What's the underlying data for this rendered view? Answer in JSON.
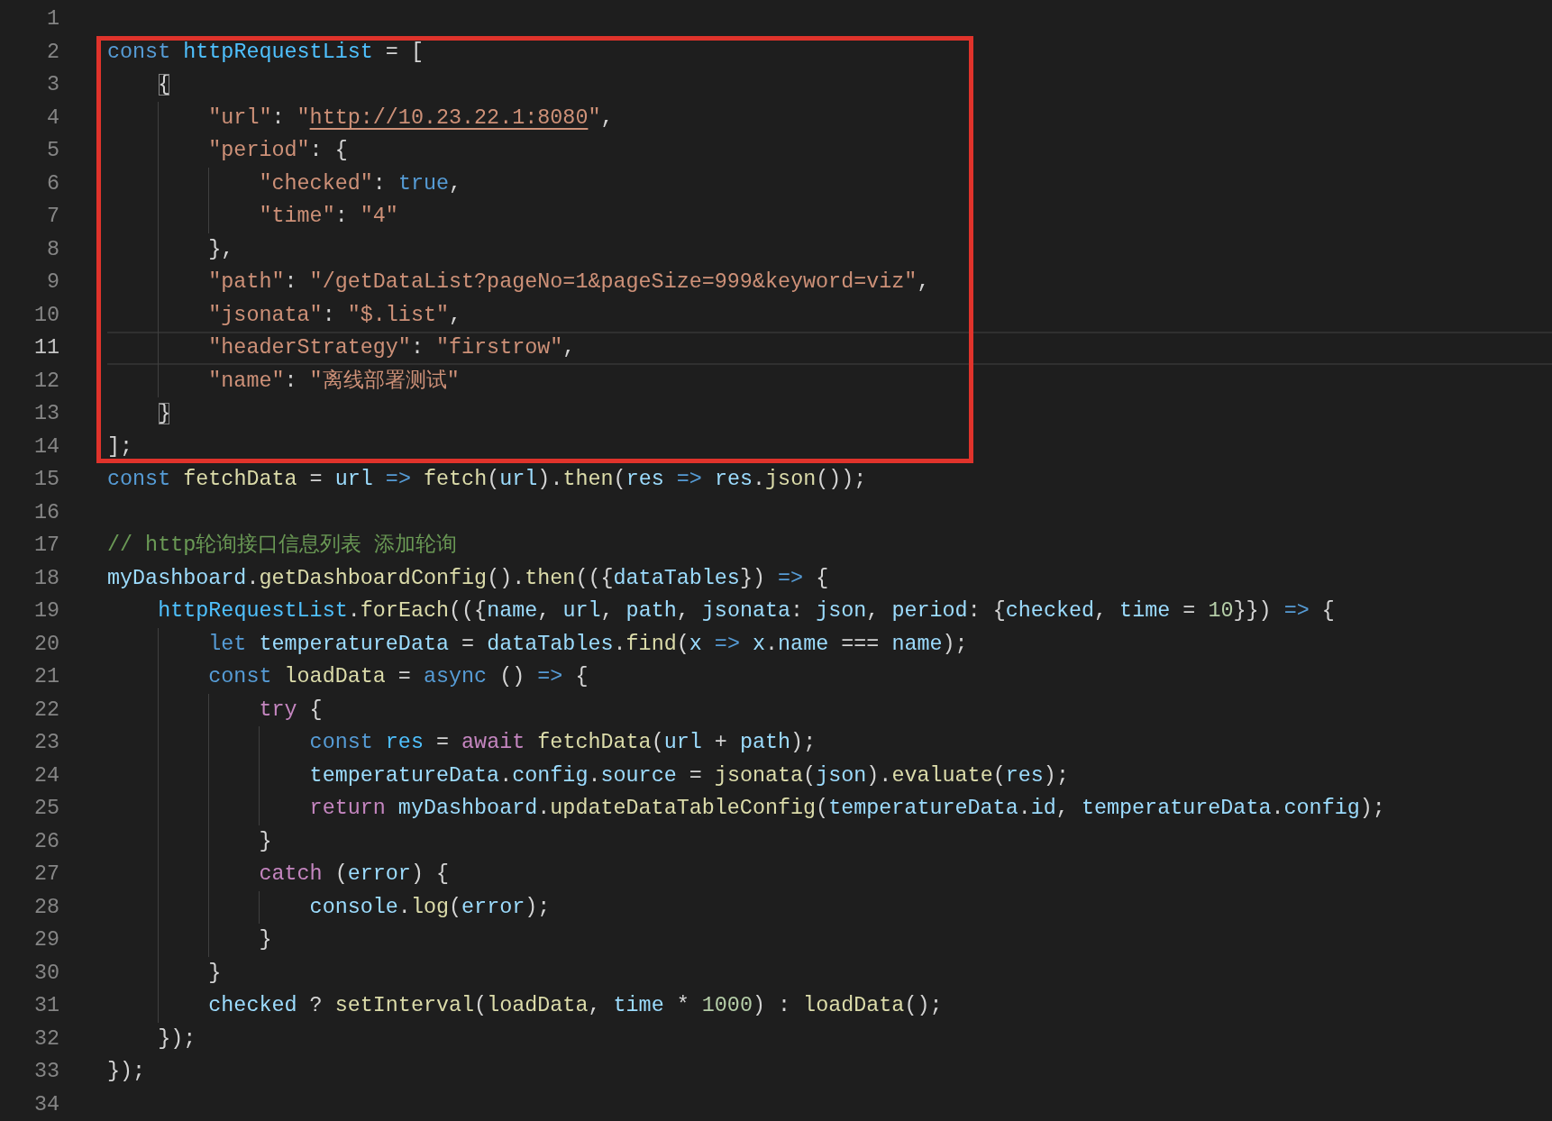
{
  "lines": [
    {
      "number": "1",
      "current": false,
      "in_box": false
    },
    {
      "number": "2",
      "current": false,
      "in_box": true,
      "tokens": [
        {
          "kind": "kw",
          "text": "const "
        },
        {
          "kind": "cst",
          "text": "httpRequestList"
        },
        {
          "kind": "p",
          "text": " = ["
        }
      ]
    },
    {
      "number": "3",
      "current": false,
      "in_box": true,
      "tokens": [
        {
          "kind": "match",
          "text": "    {"
        }
      ]
    },
    {
      "number": "4",
      "current": false,
      "in_box": true,
      "tokens": [
        {
          "kind": "str",
          "text": "        \"url\""
        },
        {
          "kind": "p",
          "text": ": "
        },
        {
          "kind": "str",
          "text": "\""
        },
        {
          "kind": "link",
          "text": "http://10.23.22.1:8080"
        },
        {
          "kind": "str",
          "text": "\""
        },
        {
          "kind": "p",
          "text": ","
        }
      ]
    },
    {
      "number": "5",
      "current": false,
      "in_box": true,
      "tokens": [
        {
          "kind": "str",
          "text": "        \"period\""
        },
        {
          "kind": "p",
          "text": ": {"
        }
      ]
    },
    {
      "number": "6",
      "current": false,
      "in_box": true,
      "tokens": [
        {
          "kind": "str",
          "text": "            \"checked\""
        },
        {
          "kind": "p",
          "text": ": "
        },
        {
          "kind": "kw",
          "text": "true"
        },
        {
          "kind": "p",
          "text": ","
        }
      ]
    },
    {
      "number": "7",
      "current": false,
      "in_box": true,
      "tokens": [
        {
          "kind": "str",
          "text": "            \"time\""
        },
        {
          "kind": "p",
          "text": ": "
        },
        {
          "kind": "str",
          "text": "\"4\""
        }
      ]
    },
    {
      "number": "8",
      "current": false,
      "in_box": true,
      "tokens": [
        {
          "kind": "p",
          "text": "        },"
        }
      ]
    },
    {
      "number": "9",
      "current": false,
      "in_box": true,
      "tokens": [
        {
          "kind": "str",
          "text": "        \"path\""
        },
        {
          "kind": "p",
          "text": ": "
        },
        {
          "kind": "str",
          "text": "\"/getDataList?pageNo=1&pageSize=999&keyword=viz\""
        },
        {
          "kind": "p",
          "text": ","
        }
      ]
    },
    {
      "number": "10",
      "current": false,
      "in_box": true,
      "tokens": [
        {
          "kind": "str",
          "text": "        \"jsonata\""
        },
        {
          "kind": "p",
          "text": ": "
        },
        {
          "kind": "str",
          "text": "\"$.list\""
        },
        {
          "kind": "p",
          "text": ","
        }
      ]
    },
    {
      "number": "11",
      "current": true,
      "in_box": true,
      "tokens": [
        {
          "kind": "str",
          "text": "        \"headerStrategy\""
        },
        {
          "kind": "p",
          "text": ": "
        },
        {
          "kind": "str",
          "text": "\"firstrow\""
        },
        {
          "kind": "p",
          "text": ","
        }
      ]
    },
    {
      "number": "12",
      "current": false,
      "in_box": true,
      "tokens": [
        {
          "kind": "str",
          "text": "        \"name\""
        },
        {
          "kind": "p",
          "text": ": "
        },
        {
          "kind": "str",
          "text": "\"离线部署测试\""
        }
      ]
    },
    {
      "number": "13",
      "current": false,
      "in_box": true,
      "tokens": [
        {
          "kind": "match",
          "text": "    }"
        }
      ]
    },
    {
      "number": "14",
      "current": false,
      "in_box": true,
      "tokens": [
        {
          "kind": "p",
          "text": "];"
        }
      ]
    },
    {
      "number": "15",
      "current": false,
      "in_box": false,
      "tokens": [
        {
          "kind": "kw",
          "text": "const "
        },
        {
          "kind": "fn",
          "text": "fetchData"
        },
        {
          "kind": "p",
          "text": " = "
        },
        {
          "kind": "var",
          "text": "url"
        },
        {
          "kind": "kw",
          "text": " => "
        },
        {
          "kind": "fn",
          "text": "fetch"
        },
        {
          "kind": "p",
          "text": "("
        },
        {
          "kind": "var",
          "text": "url"
        },
        {
          "kind": "p",
          "text": ")."
        },
        {
          "kind": "fn",
          "text": "then"
        },
        {
          "kind": "p",
          "text": "("
        },
        {
          "kind": "var",
          "text": "res"
        },
        {
          "kind": "kw",
          "text": " => "
        },
        {
          "kind": "var",
          "text": "res"
        },
        {
          "kind": "p",
          "text": "."
        },
        {
          "kind": "fn",
          "text": "json"
        },
        {
          "kind": "p",
          "text": "());"
        }
      ]
    },
    {
      "number": "16",
      "current": false,
      "in_box": false
    },
    {
      "number": "17",
      "current": false,
      "in_box": false,
      "tokens": [
        {
          "kind": "cmt",
          "text": "// http轮询接口信息列表 添加轮询"
        }
      ]
    },
    {
      "number": "18",
      "current": false,
      "in_box": false,
      "tokens": [
        {
          "kind": "var",
          "text": "myDashboard"
        },
        {
          "kind": "p",
          "text": "."
        },
        {
          "kind": "fn",
          "text": "getDashboardConfig"
        },
        {
          "kind": "p",
          "text": "()."
        },
        {
          "kind": "fn",
          "text": "then"
        },
        {
          "kind": "p",
          "text": "(({"
        },
        {
          "kind": "var",
          "text": "dataTables"
        },
        {
          "kind": "p",
          "text": "}) "
        },
        {
          "kind": "kw",
          "text": "=>"
        },
        {
          "kind": "p",
          "text": " {"
        }
      ]
    },
    {
      "number": "19",
      "current": false,
      "in_box": false,
      "tokens": [
        {
          "kind": "cst",
          "text": "    httpRequestList"
        },
        {
          "kind": "p",
          "text": "."
        },
        {
          "kind": "fn",
          "text": "forEach"
        },
        {
          "kind": "p",
          "text": "(({"
        },
        {
          "kind": "var",
          "text": "name"
        },
        {
          "kind": "p",
          "text": ", "
        },
        {
          "kind": "var",
          "text": "url"
        },
        {
          "kind": "p",
          "text": ", "
        },
        {
          "kind": "var",
          "text": "path"
        },
        {
          "kind": "p",
          "text": ", "
        },
        {
          "kind": "var",
          "text": "jsonata"
        },
        {
          "kind": "p",
          "text": ": "
        },
        {
          "kind": "var",
          "text": "json"
        },
        {
          "kind": "p",
          "text": ", "
        },
        {
          "kind": "var",
          "text": "period"
        },
        {
          "kind": "p",
          "text": ": {"
        },
        {
          "kind": "var",
          "text": "checked"
        },
        {
          "kind": "p",
          "text": ", "
        },
        {
          "kind": "var",
          "text": "time"
        },
        {
          "kind": "p",
          "text": " = "
        },
        {
          "kind": "num",
          "text": "10"
        },
        {
          "kind": "p",
          "text": "}}) "
        },
        {
          "kind": "kw",
          "text": "=>"
        },
        {
          "kind": "p",
          "text": " {"
        }
      ]
    },
    {
      "number": "20",
      "current": false,
      "in_box": false,
      "tokens": [
        {
          "kind": "kw",
          "text": "        let "
        },
        {
          "kind": "var",
          "text": "temperatureData"
        },
        {
          "kind": "p",
          "text": " = "
        },
        {
          "kind": "var",
          "text": "dataTables"
        },
        {
          "kind": "p",
          "text": "."
        },
        {
          "kind": "fn",
          "text": "find"
        },
        {
          "kind": "p",
          "text": "("
        },
        {
          "kind": "var",
          "text": "x"
        },
        {
          "kind": "kw",
          "text": " => "
        },
        {
          "kind": "var",
          "text": "x"
        },
        {
          "kind": "p",
          "text": "."
        },
        {
          "kind": "var",
          "text": "name"
        },
        {
          "kind": "p",
          "text": " === "
        },
        {
          "kind": "var",
          "text": "name"
        },
        {
          "kind": "p",
          "text": ");"
        }
      ]
    },
    {
      "number": "21",
      "current": false,
      "in_box": false,
      "tokens": [
        {
          "kind": "kw",
          "text": "        const "
        },
        {
          "kind": "fn",
          "text": "loadData"
        },
        {
          "kind": "p",
          "text": " = "
        },
        {
          "kind": "kw",
          "text": "async"
        },
        {
          "kind": "p",
          "text": " () "
        },
        {
          "kind": "kw",
          "text": "=>"
        },
        {
          "kind": "p",
          "text": " {"
        }
      ]
    },
    {
      "number": "22",
      "current": false,
      "in_box": false,
      "tokens": [
        {
          "kind": "ctl",
          "text": "            try"
        },
        {
          "kind": "p",
          "text": " {"
        }
      ]
    },
    {
      "number": "23",
      "current": false,
      "in_box": false,
      "tokens": [
        {
          "kind": "kw",
          "text": "                const "
        },
        {
          "kind": "cst",
          "text": "res"
        },
        {
          "kind": "p",
          "text": " = "
        },
        {
          "kind": "ctl",
          "text": "await "
        },
        {
          "kind": "fn",
          "text": "fetchData"
        },
        {
          "kind": "p",
          "text": "("
        },
        {
          "kind": "var",
          "text": "url"
        },
        {
          "kind": "p",
          "text": " + "
        },
        {
          "kind": "var",
          "text": "path"
        },
        {
          "kind": "p",
          "text": ");"
        }
      ]
    },
    {
      "number": "24",
      "current": false,
      "in_box": false,
      "tokens": [
        {
          "kind": "var",
          "text": "                temperatureData"
        },
        {
          "kind": "p",
          "text": "."
        },
        {
          "kind": "var",
          "text": "config"
        },
        {
          "kind": "p",
          "text": "."
        },
        {
          "kind": "var",
          "text": "source"
        },
        {
          "kind": "p",
          "text": " = "
        },
        {
          "kind": "fn",
          "text": "jsonata"
        },
        {
          "kind": "p",
          "text": "("
        },
        {
          "kind": "var",
          "text": "json"
        },
        {
          "kind": "p",
          "text": ")."
        },
        {
          "kind": "fn",
          "text": "evaluate"
        },
        {
          "kind": "p",
          "text": "("
        },
        {
          "kind": "var",
          "text": "res"
        },
        {
          "kind": "p",
          "text": ");"
        }
      ]
    },
    {
      "number": "25",
      "current": false,
      "in_box": false,
      "tokens": [
        {
          "kind": "ctl",
          "text": "                return "
        },
        {
          "kind": "var",
          "text": "myDashboard"
        },
        {
          "kind": "p",
          "text": "."
        },
        {
          "kind": "fn",
          "text": "updateDataTableConfig"
        },
        {
          "kind": "p",
          "text": "("
        },
        {
          "kind": "var",
          "text": "temperatureData"
        },
        {
          "kind": "p",
          "text": "."
        },
        {
          "kind": "var",
          "text": "id"
        },
        {
          "kind": "p",
          "text": ", "
        },
        {
          "kind": "var",
          "text": "temperatureData"
        },
        {
          "kind": "p",
          "text": "."
        },
        {
          "kind": "var",
          "text": "config"
        },
        {
          "kind": "p",
          "text": ");"
        }
      ]
    },
    {
      "number": "26",
      "current": false,
      "in_box": false,
      "tokens": [
        {
          "kind": "p",
          "text": "            }"
        }
      ]
    },
    {
      "number": "27",
      "current": false,
      "in_box": false,
      "tokens": [
        {
          "kind": "ctl",
          "text": "            catch"
        },
        {
          "kind": "p",
          "text": " ("
        },
        {
          "kind": "var",
          "text": "error"
        },
        {
          "kind": "p",
          "text": ") {"
        }
      ]
    },
    {
      "number": "28",
      "current": false,
      "in_box": false,
      "tokens": [
        {
          "kind": "var",
          "text": "                console"
        },
        {
          "kind": "p",
          "text": "."
        },
        {
          "kind": "fn",
          "text": "log"
        },
        {
          "kind": "p",
          "text": "("
        },
        {
          "kind": "var",
          "text": "error"
        },
        {
          "kind": "p",
          "text": ");"
        }
      ]
    },
    {
      "number": "29",
      "current": false,
      "in_box": false,
      "tokens": [
        {
          "kind": "p",
          "text": "            }"
        }
      ]
    },
    {
      "number": "30",
      "current": false,
      "in_box": false,
      "tokens": [
        {
          "kind": "p",
          "text": "        }"
        }
      ]
    },
    {
      "number": "31",
      "current": false,
      "in_box": false,
      "tokens": [
        {
          "kind": "var",
          "text": "        checked"
        },
        {
          "kind": "p",
          "text": " ? "
        },
        {
          "kind": "fn",
          "text": "setInterval"
        },
        {
          "kind": "p",
          "text": "("
        },
        {
          "kind": "fn",
          "text": "loadData"
        },
        {
          "kind": "p",
          "text": ", "
        },
        {
          "kind": "var",
          "text": "time"
        },
        {
          "kind": "p",
          "text": " * "
        },
        {
          "kind": "num",
          "text": "1000"
        },
        {
          "kind": "p",
          "text": ") : "
        },
        {
          "kind": "fn",
          "text": "loadData"
        },
        {
          "kind": "p",
          "text": "();"
        }
      ]
    },
    {
      "number": "32",
      "current": false,
      "in_box": false,
      "tokens": [
        {
          "kind": "p",
          "text": "    });"
        }
      ]
    },
    {
      "number": "33",
      "current": false,
      "in_box": false,
      "tokens": [
        {
          "kind": "p",
          "text": "});"
        }
      ]
    },
    {
      "number": "34",
      "current": false,
      "in_box": false
    }
  ]
}
